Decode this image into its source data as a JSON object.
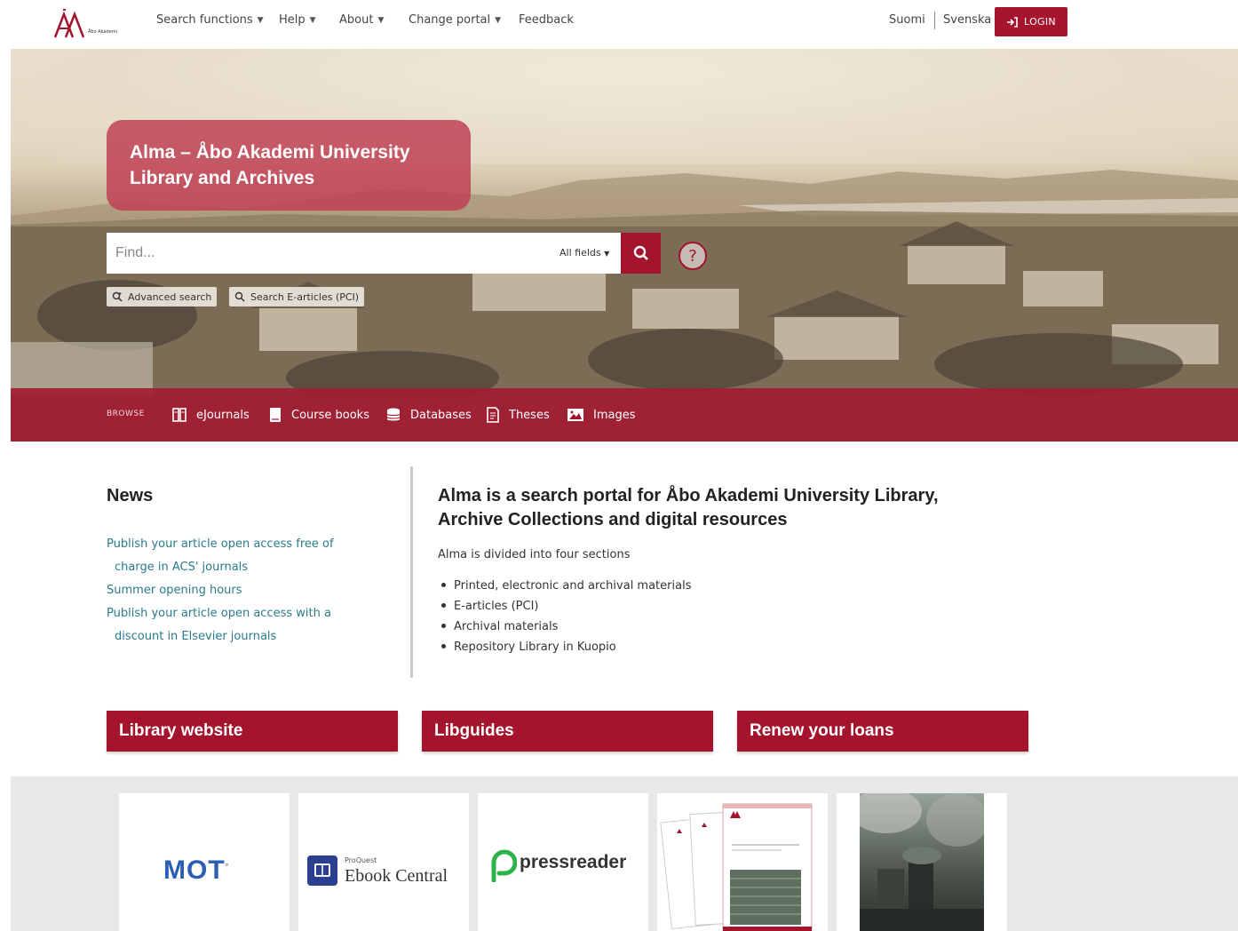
{
  "header": {
    "logo_text": "Åbo Akademi",
    "nav": [
      {
        "label": "Search functions"
      },
      {
        "label": "Help"
      },
      {
        "label": "About"
      },
      {
        "label": "Change portal"
      },
      {
        "label": "Feedback"
      }
    ],
    "languages": [
      "Suomi",
      "Svenska"
    ],
    "login_label": "LOGIN"
  },
  "hero": {
    "title": "Alma – Åbo Akademi University Library and Archives",
    "search": {
      "placeholder": "Find...",
      "field_selector": "All fields",
      "help_symbol": "?"
    },
    "advanced_search": "Advanced search",
    "search_earticles": "Search E-articles (PCI)",
    "browse": {
      "label": "BROWSE",
      "items": [
        {
          "label": "eJournals",
          "icon": "journal-icon"
        },
        {
          "label": "Course books",
          "icon": "book-icon"
        },
        {
          "label": "Databases",
          "icon": "database-icon"
        },
        {
          "label": "Theses",
          "icon": "thesis-icon"
        },
        {
          "label": "Images",
          "icon": "image-icon"
        }
      ]
    }
  },
  "news": {
    "title": "News",
    "items": [
      {
        "line1": "Publish your article open access free of",
        "line2": "charge in ACS' journals"
      },
      {
        "line1": "Summer opening hours",
        "line2": ""
      },
      {
        "line1": "Publish your article open access with a",
        "line2": "discount in Elsevier journals"
      }
    ]
  },
  "about": {
    "title": "Alma is a search portal for Åbo Akademi University Library, Archive Collections and digital resources",
    "intro": "Alma is divided into four sections",
    "sections": [
      "Printed, electronic and archival materials",
      "E-articles (PCI)",
      "Archival materials",
      "Repository Library in Kuopio"
    ]
  },
  "cta": [
    "Library website",
    "Libguides",
    "Renew your loans"
  ],
  "resources": {
    "mot": "MOT",
    "proquest_small": "ProQuest",
    "proquest_name": "Ebook Central",
    "pressreader": "pressreader"
  },
  "colors": {
    "brand": "#a4142d",
    "link": "#2a7a8c"
  }
}
